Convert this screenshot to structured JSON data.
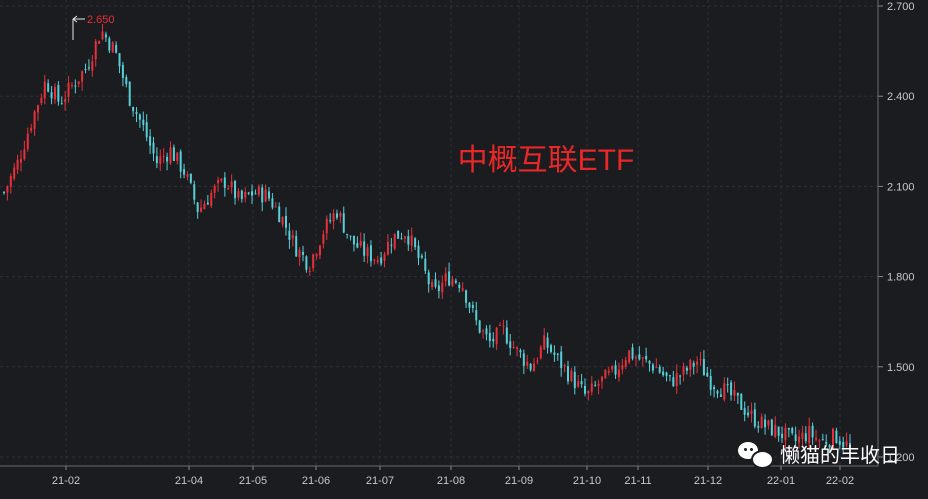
{
  "chart_data": {
    "type": "candlestick",
    "title": "中概互联ETF",
    "y_ticks": [
      "2.700",
      "2.400",
      "2.100",
      "1.800",
      "1.500",
      "1.200"
    ],
    "ylim": [
      1.17,
      2.72
    ],
    "x_ticks": [
      "21-02",
      "21-04",
      "21-05",
      "21-06",
      "21-07",
      "21-08",
      "21-09",
      "21-10",
      "21-11",
      "21-12",
      "22-01",
      "22-02"
    ],
    "max_annotation": "2.650",
    "grid": true,
    "colors": {
      "up": "#e8303a",
      "down": "#56d0d8",
      "axis_text": "#c8c8c8",
      "grid": "#2e3038",
      "title": "#e82828"
    },
    "closes": [
      2.08,
      2.18,
      2.32,
      2.45,
      2.38,
      2.44,
      2.5,
      2.62,
      2.55,
      2.4,
      2.3,
      2.18,
      2.22,
      2.15,
      2.02,
      2.08,
      2.12,
      2.05,
      2.08,
      2.07,
      2.0,
      1.9,
      1.84,
      1.95,
      2.02,
      1.92,
      1.88,
      1.86,
      1.93,
      1.95,
      1.85,
      1.74,
      1.8,
      1.78,
      1.65,
      1.58,
      1.62,
      1.55,
      1.5,
      1.58,
      1.52,
      1.46,
      1.4,
      1.45,
      1.48,
      1.55,
      1.52,
      1.5,
      1.45,
      1.48,
      1.52,
      1.45,
      1.42,
      1.38,
      1.33,
      1.3,
      1.28,
      1.25,
      1.28,
      1.25,
      1.27,
      1.23
    ]
  },
  "watermark": {
    "text": "懒猫的丰收日",
    "icon": "wechat-icon"
  }
}
